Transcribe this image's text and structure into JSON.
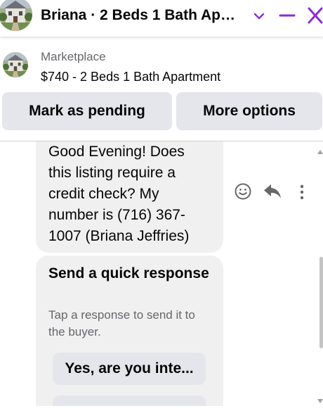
{
  "header": {
    "title": "Briana · 2 Beds 1 Bath Apa...",
    "accent_color": "#8a2be2",
    "icons": {
      "options": "chevron-down-icon",
      "minimize": "minimize-icon",
      "close": "close-icon"
    }
  },
  "listing": {
    "category": "Marketplace",
    "name": "$740 - 2 Beds 1 Bath Apartment"
  },
  "actions": {
    "pending_label": "Mark as pending",
    "more_label": "More options"
  },
  "message": {
    "text": "Good Evening! Does this listing require a credit check? My number is (716) 367-1007 (Briana Jeffries)",
    "icons": [
      "emoji-icon",
      "reply-icon",
      "more-vertical-icon"
    ]
  },
  "quick_response": {
    "title": "Send a quick response",
    "subtitle": "Tap a response to send it to the buyer.",
    "options": [
      "Yes, are you inte...",
      ""
    ]
  }
}
